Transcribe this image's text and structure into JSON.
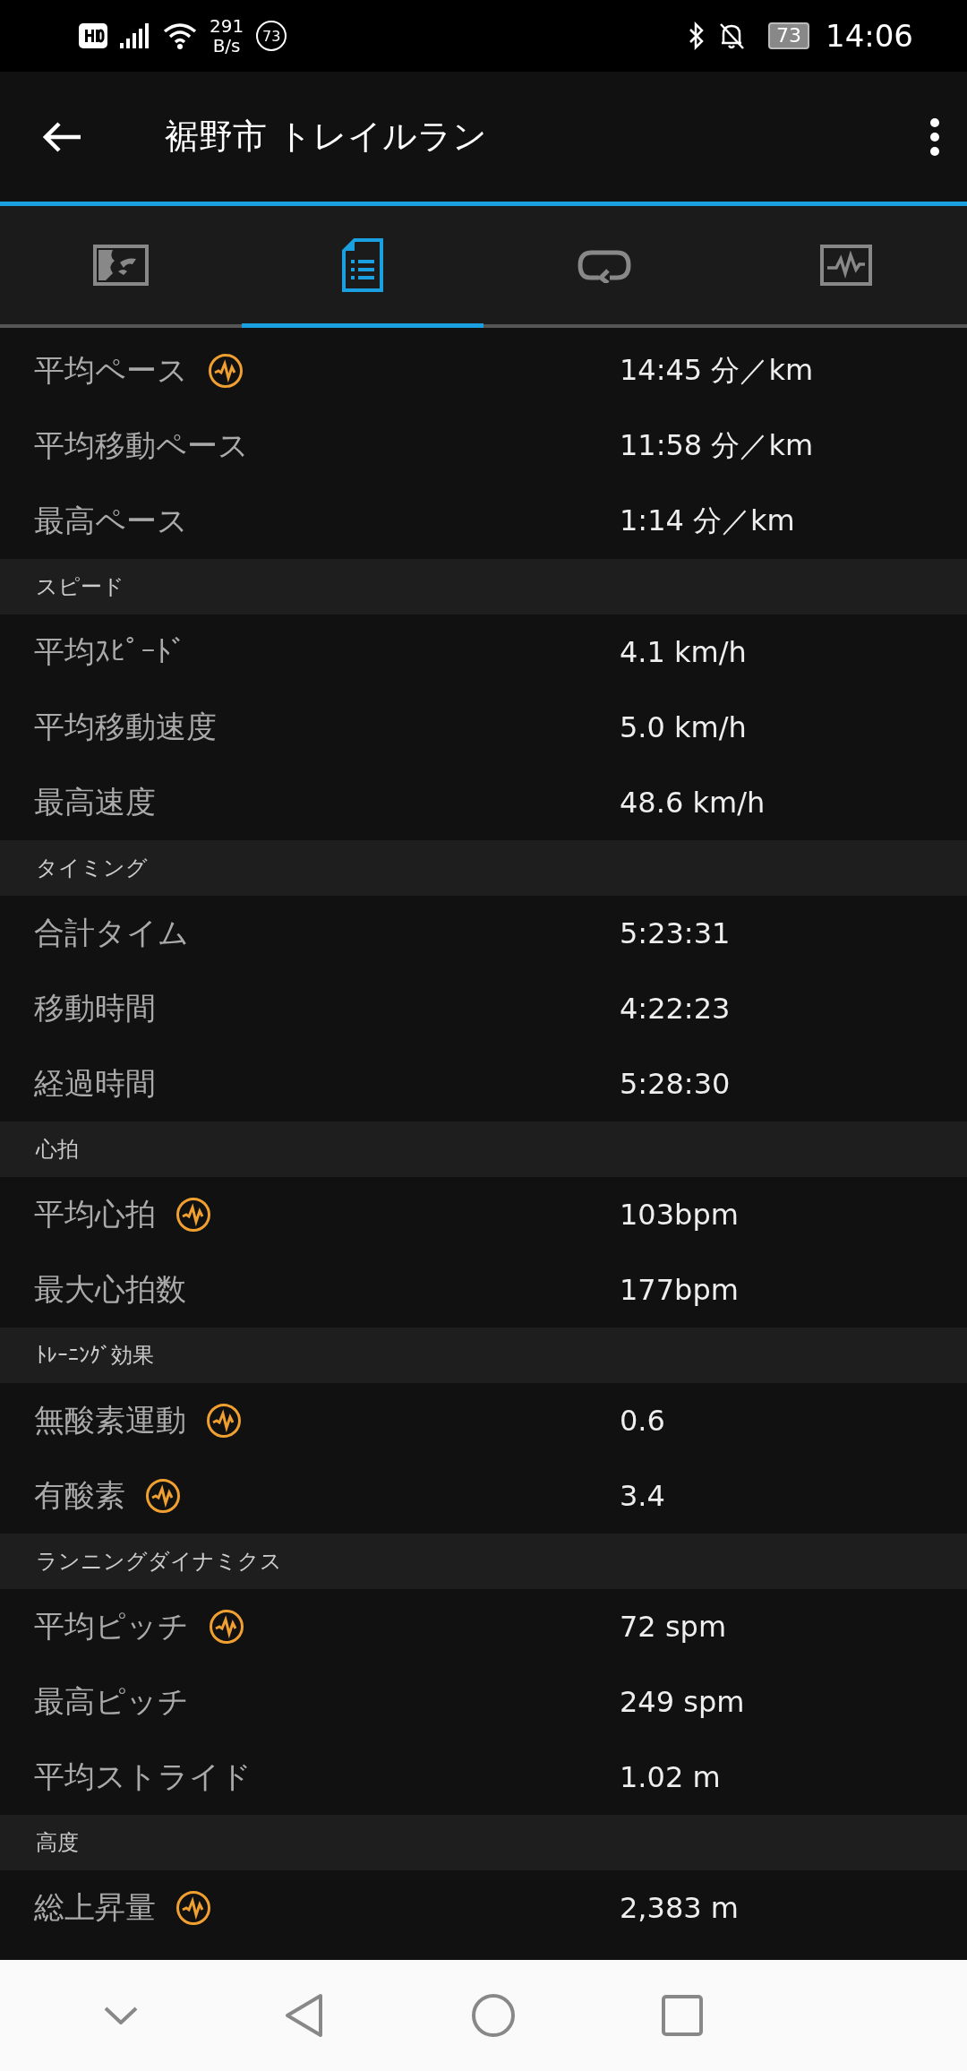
{
  "status_bar": {
    "net_speed": "291",
    "net_unit": "B/s",
    "badge": "73",
    "battery": "73",
    "time": "14:06"
  },
  "app_bar": {
    "title": "裾野市 トレイルラン"
  },
  "tabs": [
    {
      "kind": "map",
      "selected": false
    },
    {
      "kind": "details",
      "selected": true
    },
    {
      "kind": "laps",
      "selected": false
    },
    {
      "kind": "chart",
      "selected": false
    }
  ],
  "sections": [
    {
      "rows": [
        {
          "label": "平均ペース",
          "chart": true,
          "value": "14:45 分／km"
        },
        {
          "label": "平均移動ペース",
          "chart": false,
          "value": "11:58 分／km"
        },
        {
          "label": "最高ペース",
          "chart": false,
          "value": "1:14 分／km"
        }
      ]
    },
    {
      "header": "スピード",
      "rows": [
        {
          "label": "平均ｽﾋﾟｰﾄﾞ",
          "chart": false,
          "value": "4.1 km/h"
        },
        {
          "label": "平均移動速度",
          "chart": false,
          "value": "5.0 km/h"
        },
        {
          "label": "最高速度",
          "chart": false,
          "value": "48.6 km/h"
        }
      ]
    },
    {
      "header": "タイミング",
      "rows": [
        {
          "label": "合計タイム",
          "chart": false,
          "value": "5:23:31"
        },
        {
          "label": "移動時間",
          "chart": false,
          "value": "4:22:23"
        },
        {
          "label": "経過時間",
          "chart": false,
          "value": "5:28:30"
        }
      ]
    },
    {
      "header": "心拍",
      "rows": [
        {
          "label": "平均心拍",
          "chart": true,
          "value": "103bpm"
        },
        {
          "label": "最大心拍数",
          "chart": false,
          "value": "177bpm"
        }
      ]
    },
    {
      "header": "ﾄﾚｰﾆﾝｸﾞ効果",
      "rows": [
        {
          "label": "無酸素運動",
          "chart": true,
          "value": "0.6"
        },
        {
          "label": "有酸素",
          "chart": true,
          "value": "3.4"
        }
      ]
    },
    {
      "header": "ランニングダイナミクス",
      "rows": [
        {
          "label": "平均ピッチ",
          "chart": true,
          "value": "72 spm"
        },
        {
          "label": "最高ピッチ",
          "chart": false,
          "value": "249 spm"
        },
        {
          "label": "平均ストライド",
          "chart": false,
          "value": "1.02 m"
        }
      ]
    },
    {
      "header": "高度",
      "rows": [
        {
          "label": "総上昇量",
          "chart": true,
          "value": "2,383 m"
        }
      ]
    }
  ]
}
